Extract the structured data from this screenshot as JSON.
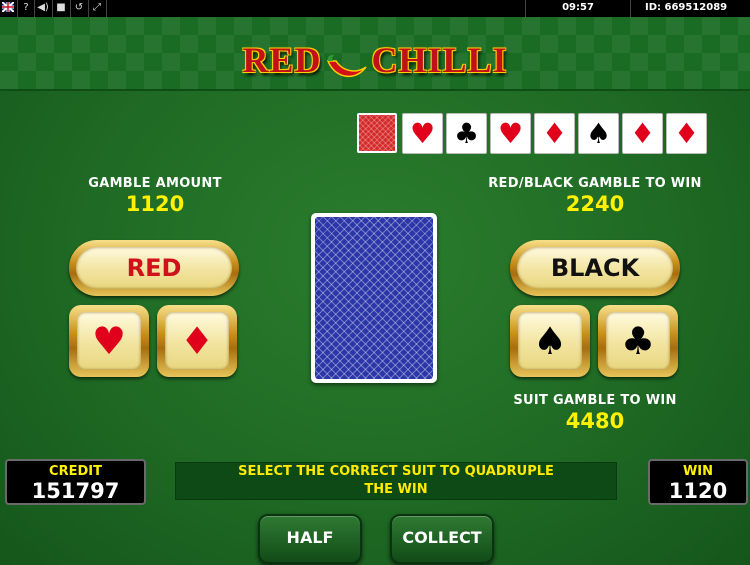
{
  "topbar": {
    "clock": "09:57",
    "id_label": "ID: 669512089",
    "icons": [
      "flag-icon",
      "help-icon",
      "sound-icon",
      "stop-icon",
      "history-icon",
      "fullscreen-icon"
    ],
    "icon_glyphs": [
      "?",
      "◀)",
      "■",
      "↺",
      "⤢"
    ]
  },
  "logo": {
    "left": "RED",
    "right": "CHILLI"
  },
  "history": [
    {
      "type": "back"
    },
    {
      "suit": "heart",
      "glyph": "♥",
      "color": "red"
    },
    {
      "suit": "club",
      "glyph": "♣",
      "color": "black"
    },
    {
      "suit": "heart",
      "glyph": "♥",
      "color": "red"
    },
    {
      "suit": "diamond",
      "glyph": "♦",
      "color": "red"
    },
    {
      "suit": "spade",
      "glyph": "♠",
      "color": "black"
    },
    {
      "suit": "diamond",
      "glyph": "♦",
      "color": "red"
    },
    {
      "suit": "diamond",
      "glyph": "♦",
      "color": "red"
    }
  ],
  "gamble": {
    "amount_label": "GAMBLE AMOUNT",
    "amount_value": "1120",
    "redblack_label": "RED/BLACK GAMBLE TO WIN",
    "redblack_value": "2240",
    "suit_label": "SUIT GAMBLE TO WIN",
    "suit_value": "4480"
  },
  "buttons": {
    "red": "RED",
    "black": "BLACK",
    "heart": "♥",
    "diamond": "♦",
    "spade": "♠",
    "club": "♣",
    "half": "HALF",
    "collect": "COLLECT"
  },
  "credit": {
    "label": "CREDIT",
    "value": "151797"
  },
  "win": {
    "label": "WIN",
    "value": "1120"
  },
  "message": {
    "line1": "SELECT THE CORRECT SUIT TO QUADRUPLE",
    "line2": "THE WIN"
  },
  "colors": {
    "red_suit": "#e0001b",
    "gold": "#c98f1b",
    "value_yellow": "#fff200",
    "felt_green": "#1f6a24"
  }
}
